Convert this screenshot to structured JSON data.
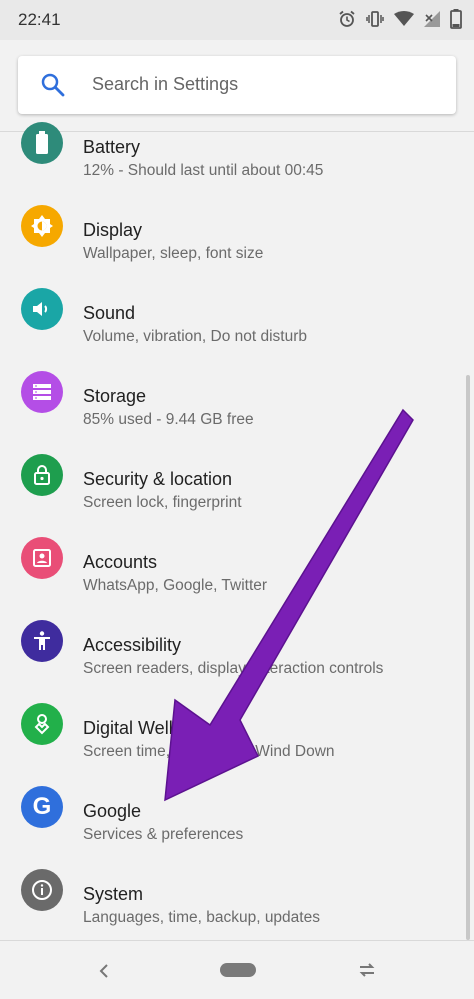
{
  "status_bar": {
    "time": "22:41"
  },
  "search": {
    "placeholder": "Search in Settings"
  },
  "settings_items": [
    {
      "title": "Battery",
      "subtitle": "12% - Should last until about 00:45",
      "color": "#2e8b7a",
      "icon": "battery-icon"
    },
    {
      "title": "Display",
      "subtitle": "Wallpaper, sleep, font size",
      "color": "#f6a800",
      "icon": "brightness-icon"
    },
    {
      "title": "Sound",
      "subtitle": "Volume, vibration, Do not disturb",
      "color": "#1aa6a6",
      "icon": "volume-icon"
    },
    {
      "title": "Storage",
      "subtitle": "85% used - 9.44 GB free",
      "color": "#b44ee6",
      "icon": "storage-icon"
    },
    {
      "title": "Security & location",
      "subtitle": "Screen lock, fingerprint",
      "color": "#1e9e4e",
      "icon": "lock-icon"
    },
    {
      "title": "Accounts",
      "subtitle": "WhatsApp, Google, Twitter",
      "color": "#e94e77",
      "icon": "account-icon"
    },
    {
      "title": "Accessibility",
      "subtitle": "Screen readers, display, interaction controls",
      "color": "#3f2c9e",
      "icon": "accessibility-icon"
    },
    {
      "title": "Digital Wellbeing",
      "subtitle": "Screen time, app timers, Wind Down",
      "color": "#22b04a",
      "icon": "wellbeing-icon"
    },
    {
      "title": "Google",
      "subtitle": "Services & preferences",
      "color": "#2f6fdc",
      "icon": "google-icon"
    },
    {
      "title": "System",
      "subtitle": "Languages, time, backup, updates",
      "color": "#6a6a6a",
      "icon": "info-icon"
    }
  ],
  "annotation": {
    "arrow_color": "#7a1fb5"
  }
}
